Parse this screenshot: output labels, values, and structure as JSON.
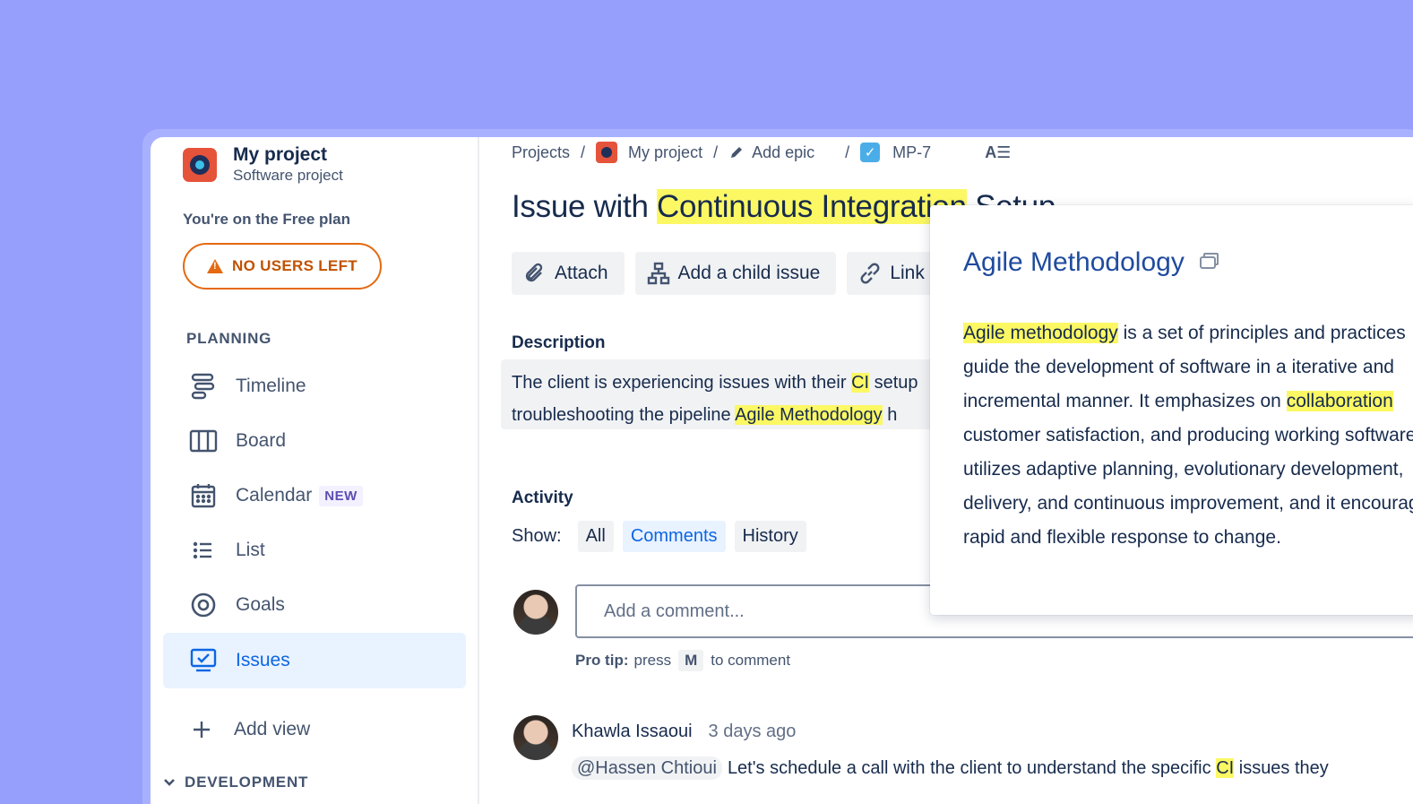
{
  "sidebar": {
    "project_name": "My project",
    "project_type": "Software project",
    "plan_text": "You're on the Free plan",
    "no_users_label": "NO USERS LEFT",
    "planning_header": "PLANNING",
    "items": [
      {
        "label": "Timeline"
      },
      {
        "label": "Board"
      },
      {
        "label": "Calendar",
        "badge": "NEW"
      },
      {
        "label": "List"
      },
      {
        "label": "Goals"
      },
      {
        "label": "Issues"
      }
    ],
    "add_view": "Add view",
    "development_header": "DEVELOPMENT"
  },
  "breadcrumb": {
    "projects": "Projects",
    "project": "My project",
    "epic": "Add epic",
    "issue_key": "MP-7"
  },
  "issue": {
    "title_pre": "Issue with ",
    "title_hl": "Continuous Integration",
    "title_post": " Setup",
    "actions": {
      "attach": "Attach",
      "add_child": "Add a child issue",
      "link": "Link issue"
    },
    "description_header": "Description",
    "description_line1_pre": "The client is experiencing issues with their ",
    "description_line1_hl": "CI",
    "description_line1_post": " setup",
    "description_line2_pre": "troubleshooting the pipeline ",
    "description_line2_hl": "Agile Methodology",
    "description_line2_post": " h"
  },
  "activity": {
    "header": "Activity",
    "show_label": "Show:",
    "filters": [
      "All",
      "Comments",
      "History"
    ],
    "comment_placeholder": "Add a comment...",
    "protip_bold": "Pro tip:",
    "protip_press": "press",
    "protip_key": "M",
    "protip_rest": "to comment",
    "comment": {
      "author": "Khawla Issaoui",
      "time": "3 days ago",
      "mention": "@Hassen Chtioui",
      "text_pre": "Let's schedule a call with the client to understand the specific ",
      "text_hl": "CI",
      "text_post": " issues they"
    }
  },
  "popup": {
    "title": "Agile Methodology",
    "line1_hl": "Agile methodology",
    "line1_rest": " is a set of principles and practices",
    "line2": "guide the development of software in a iterative and",
    "line3_pre": "incremental manner. It emphasizes on ",
    "line3_hl": "collaboration",
    "line4": "customer satisfaction, and producing working software",
    "line5": "utilizes adaptive planning, evolutionary development,",
    "line6": "delivery, and continuous improvement, and it encourages",
    "line7": "rapid and flexible response to change."
  },
  "colors": {
    "background": "#979ffd",
    "highlight": "#fcf864",
    "accent": "#0c66e4",
    "warning": "#e56910",
    "popup_title": "#1f4b9e"
  }
}
